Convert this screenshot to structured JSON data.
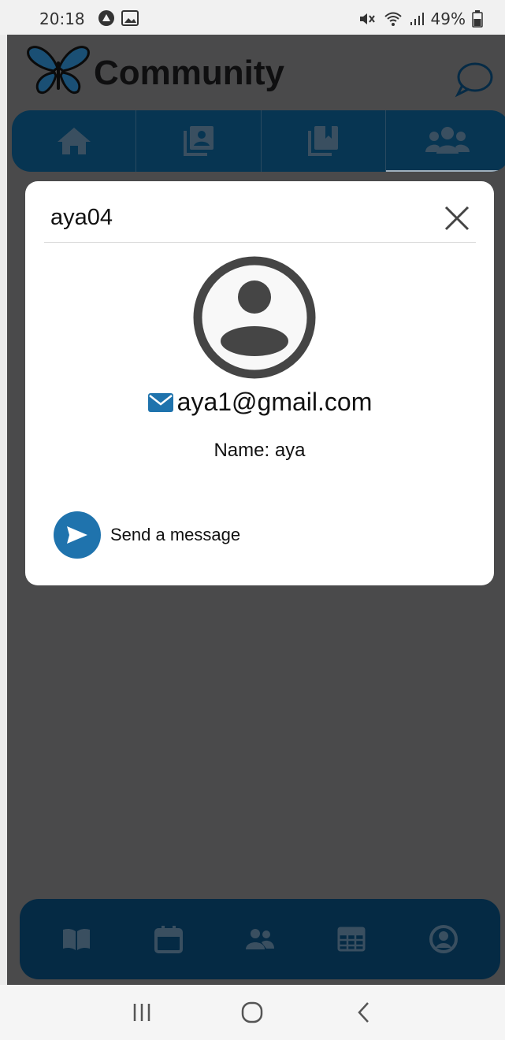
{
  "status_bar": {
    "time": "20:18",
    "battery": "49%"
  },
  "header": {
    "title": "Community",
    "icons": [
      "butterfly-logo",
      "chat-bubble-icon"
    ]
  },
  "top_nav": {
    "tabs": [
      {
        "icon": "home-icon",
        "active": false
      },
      {
        "icon": "contact-book-icon",
        "active": false
      },
      {
        "icon": "bookmark-library-icon",
        "active": false
      },
      {
        "icon": "users-icon",
        "active": true
      }
    ]
  },
  "modal": {
    "username": "aya04",
    "email": "aya1@gmail.com",
    "name_label": "Name: ",
    "name_value": "aya",
    "send_message_label": "Send a message"
  },
  "bottom_nav": {
    "items": [
      "book-open-icon",
      "calendar-icon",
      "users-icon",
      "table-icon",
      "user-circle-icon"
    ]
  },
  "colors": {
    "nav_bg": "#073552",
    "accent": "#1f73ad",
    "overlay": "#4a4a4b"
  }
}
